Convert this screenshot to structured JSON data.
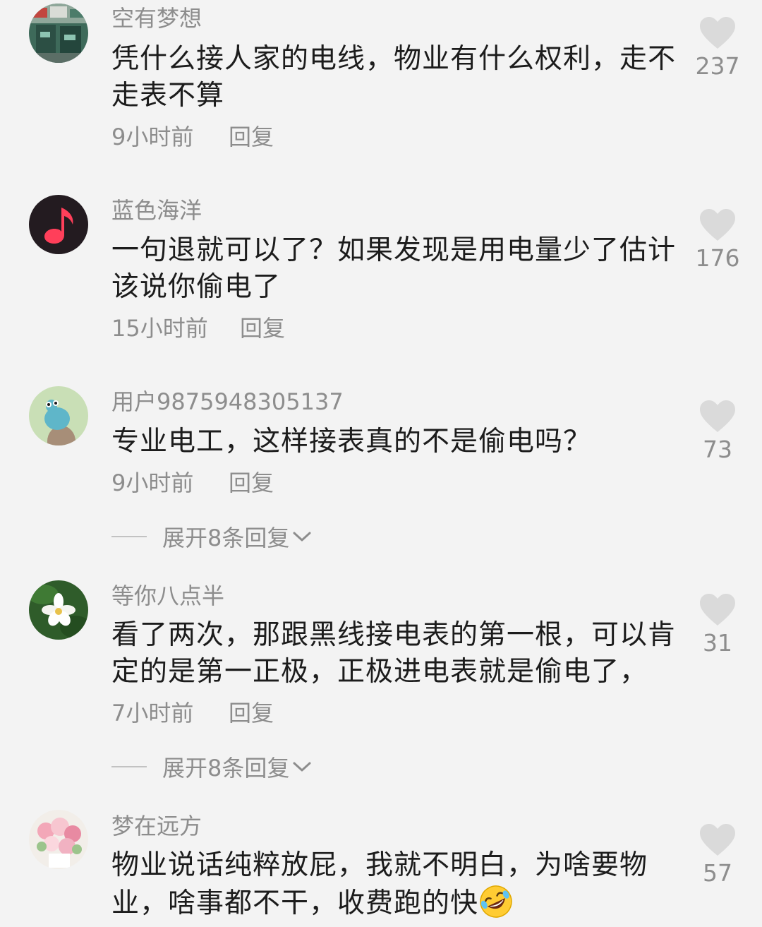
{
  "comments": [
    {
      "username": "空有梦想",
      "text": "凭什么接人家的电线，物业有什么权利，走不走表不算",
      "time": "9小时前",
      "reply": "回复",
      "likes": "237",
      "avatar": "shop-photo"
    },
    {
      "username": "蓝色海洋",
      "text": "一句退就可以了？如果发现是用电量少了估计该说你偷电了",
      "time": "15小时前",
      "reply": "回复",
      "likes": "176",
      "avatar": "music-note"
    },
    {
      "username": "用户9875948305137",
      "text": "专业电工，这样接表真的不是偷电吗？",
      "time": "9小时前",
      "reply": "回复",
      "likes": "73",
      "avatar": "cartoon-creature",
      "expand": "展开8条回复"
    },
    {
      "username": "等你八点半",
      "text": "看了两次，那跟黑线接电表的第一根，可以肯定的是第一正极，正极进电表就是偷电了，",
      "time": "7小时前",
      "reply": "回复",
      "likes": "31",
      "avatar": "white-flower",
      "expand": "展开8条回复"
    },
    {
      "username": "梦在远方",
      "text": "物业说话纯粹放屁，我就不明白，为啥要物业，啥事都不干，收费跑的快",
      "emoji": "rolling-on-floor-laughing",
      "likes": "57",
      "avatar": "flower-bouquet"
    }
  ]
}
